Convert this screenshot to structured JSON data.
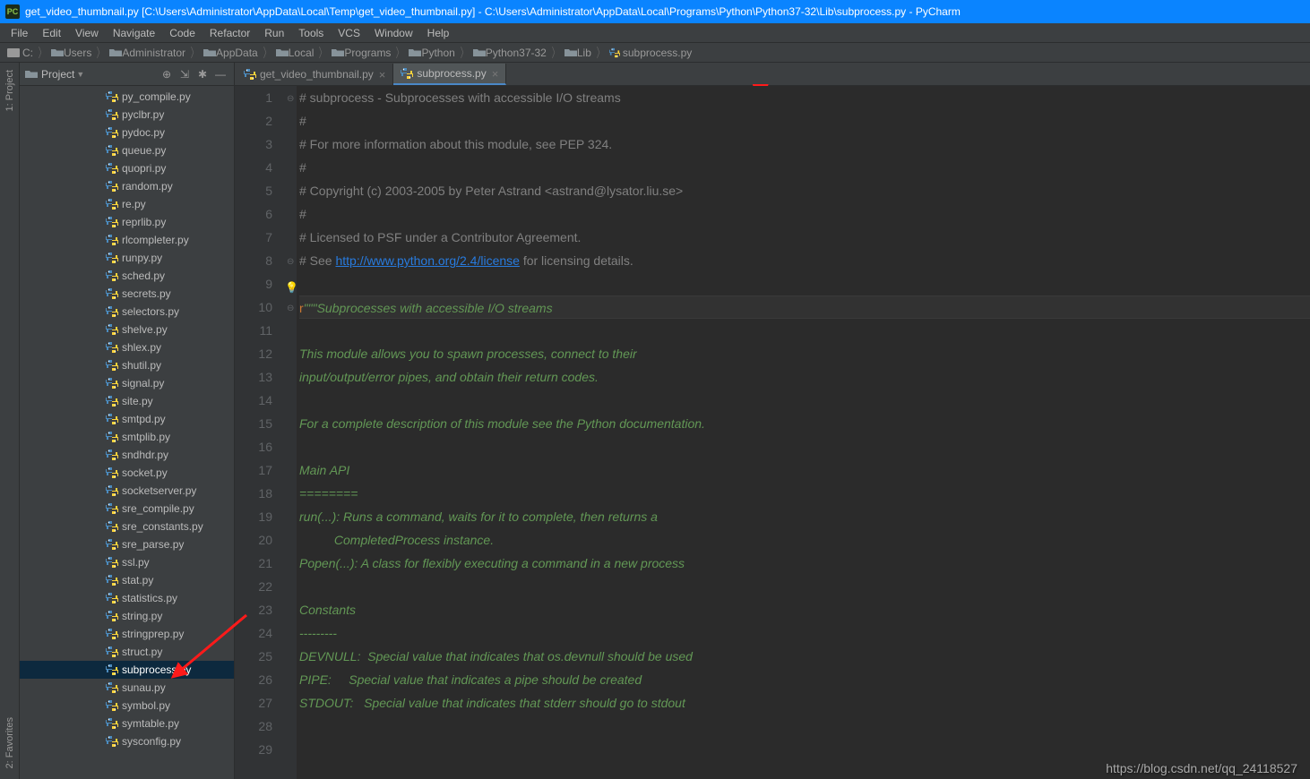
{
  "window": {
    "title": "get_video_thumbnail.py [C:\\Users\\Administrator\\AppData\\Local\\Temp\\get_video_thumbnail.py] - C:\\Users\\Administrator\\AppData\\Local\\Programs\\Python\\Python37-32\\Lib\\subprocess.py - PyCharm",
    "app_icon_label": "PC"
  },
  "menu": {
    "items": [
      "File",
      "Edit",
      "View",
      "Navigate",
      "Code",
      "Refactor",
      "Run",
      "Tools",
      "VCS",
      "Window",
      "Help"
    ]
  },
  "breadcrumb": {
    "parts": [
      "C:",
      "Users",
      "Administrator",
      "AppData",
      "Local",
      "Programs",
      "Python",
      "Python37-32",
      "Lib",
      "subprocess.py"
    ]
  },
  "leftbar": {
    "project": "1: Project",
    "favorites": "2: Favorites"
  },
  "sidebar": {
    "title": "Project",
    "files": [
      "py_compile.py",
      "pyclbr.py",
      "pydoc.py",
      "queue.py",
      "quopri.py",
      "random.py",
      "re.py",
      "reprlib.py",
      "rlcompleter.py",
      "runpy.py",
      "sched.py",
      "secrets.py",
      "selectors.py",
      "shelve.py",
      "shlex.py",
      "shutil.py",
      "signal.py",
      "site.py",
      "smtpd.py",
      "smtplib.py",
      "sndhdr.py",
      "socket.py",
      "socketserver.py",
      "sre_compile.py",
      "sre_constants.py",
      "sre_parse.py",
      "ssl.py",
      "stat.py",
      "statistics.py",
      "string.py",
      "stringprep.py",
      "struct.py",
      "subprocess.py",
      "sunau.py",
      "symbol.py",
      "symtable.py",
      "sysconfig.py"
    ],
    "selected_index": 32
  },
  "tabs": {
    "items": [
      {
        "label": "get_video_thumbnail.py",
        "active": false
      },
      {
        "label": "subprocess.py",
        "active": true
      }
    ]
  },
  "editor": {
    "current_line": 10,
    "lines": [
      {
        "n": 1,
        "type": "comment",
        "text": "# subprocess - Subprocesses with accessible I/O streams"
      },
      {
        "n": 2,
        "type": "comment",
        "text": "#"
      },
      {
        "n": 3,
        "type": "comment",
        "text": "# For more information about this module, see PEP 324."
      },
      {
        "n": 4,
        "type": "comment",
        "text": "#"
      },
      {
        "n": 5,
        "type": "comment",
        "text": "# Copyright (c) 2003-2005 by Peter Astrand <astrand@lysator.liu.se>"
      },
      {
        "n": 6,
        "type": "comment",
        "text": "#"
      },
      {
        "n": 7,
        "type": "comment",
        "text": "# Licensed to PSF under a Contributor Agreement."
      },
      {
        "n": 8,
        "type": "comment-link",
        "pre": "# See ",
        "link": "http://www.python.org/2.4/license",
        "post": " for licensing details."
      },
      {
        "n": 9,
        "type": "blank",
        "text": ""
      },
      {
        "n": 10,
        "type": "docstart",
        "prefix": "r",
        "text": "\"\"\"Subprocesses with accessible I/O streams"
      },
      {
        "n": 11,
        "type": "doc",
        "text": ""
      },
      {
        "n": 12,
        "type": "doc",
        "text": "This module allows you to spawn processes, connect to their"
      },
      {
        "n": 13,
        "type": "doc",
        "text": "input/output/error pipes, and obtain their return codes."
      },
      {
        "n": 14,
        "type": "doc",
        "text": ""
      },
      {
        "n": 15,
        "type": "doc",
        "text": "For a complete description of this module see the Python documentation."
      },
      {
        "n": 16,
        "type": "doc",
        "text": ""
      },
      {
        "n": 17,
        "type": "doc",
        "text": "Main API"
      },
      {
        "n": 18,
        "type": "doc",
        "text": "========"
      },
      {
        "n": 19,
        "type": "doc",
        "text": "run(...): Runs a command, waits for it to complete, then returns a"
      },
      {
        "n": 20,
        "type": "doc",
        "text": "          CompletedProcess instance."
      },
      {
        "n": 21,
        "type": "doc",
        "text": "Popen(...): A class for flexibly executing a command in a new process"
      },
      {
        "n": 22,
        "type": "doc",
        "text": ""
      },
      {
        "n": 23,
        "type": "doc",
        "text": "Constants"
      },
      {
        "n": 24,
        "type": "doc",
        "text": "---------"
      },
      {
        "n": 25,
        "type": "doc",
        "text": "DEVNULL:  Special value that indicates that os.devnull should be used"
      },
      {
        "n": 26,
        "type": "doc",
        "text": "PIPE:     Special value that indicates a pipe should be created"
      },
      {
        "n": 27,
        "type": "doc",
        "text": "STDOUT:   Special value that indicates that stderr should go to stdout"
      },
      {
        "n": 28,
        "type": "doc",
        "text": ""
      },
      {
        "n": 29,
        "type": "doc",
        "text": ""
      }
    ]
  },
  "watermark": "https://blog.csdn.net/qq_24118527"
}
